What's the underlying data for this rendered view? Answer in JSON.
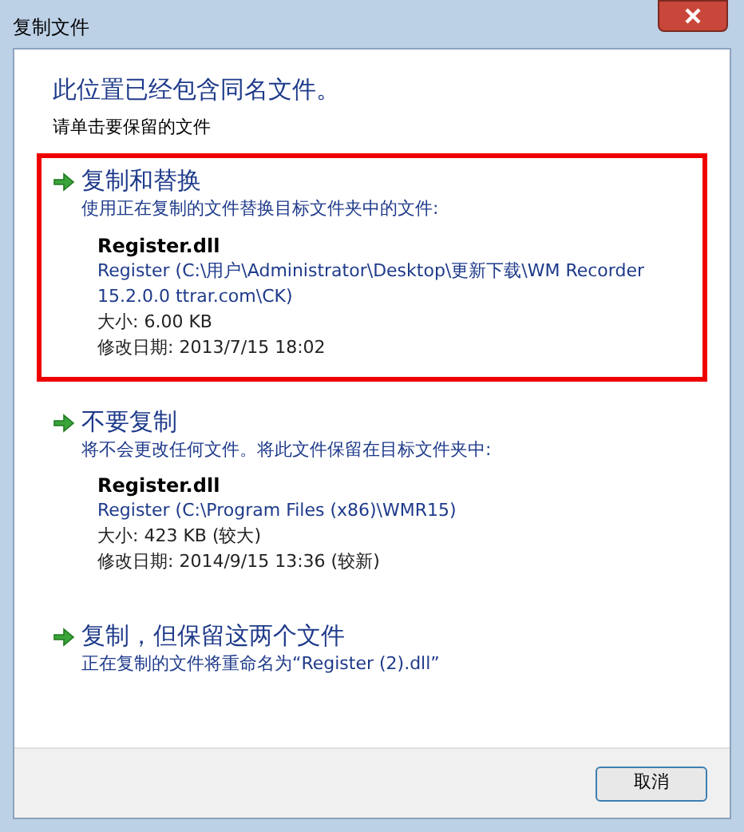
{
  "window": {
    "title": "复制文件"
  },
  "heading": "此位置已经包含同名文件。",
  "instruction": "请单击要保留的文件",
  "options": [
    {
      "title": "复制和替换",
      "description": "使用正在复制的文件替换目标文件夹中的文件:",
      "highlighted": true,
      "file": {
        "name": "Register.dll",
        "path": "Register (C:\\用户\\Administrator\\Desktop\\更新下载\\WM Recorder 15.2.0.0 ttrar.com\\CK)",
        "size": "大小: 6.00 KB",
        "modified": "修改日期: 2013/7/15 18:02"
      }
    },
    {
      "title": "不要复制",
      "description": "将不会更改任何文件。将此文件保留在目标文件夹中:",
      "highlighted": false,
      "file": {
        "name": "Register.dll",
        "path": "Register (C:\\Program Files (x86)\\WMR15)",
        "size": "大小: 423 KB (较大)",
        "modified": "修改日期: 2014/9/15 13:36 (较新)"
      }
    },
    {
      "title": "复制，但保留这两个文件",
      "description": "正在复制的文件将重命名为“Register (2).dll”",
      "highlighted": false
    }
  ],
  "buttons": [
    "取消"
  ]
}
